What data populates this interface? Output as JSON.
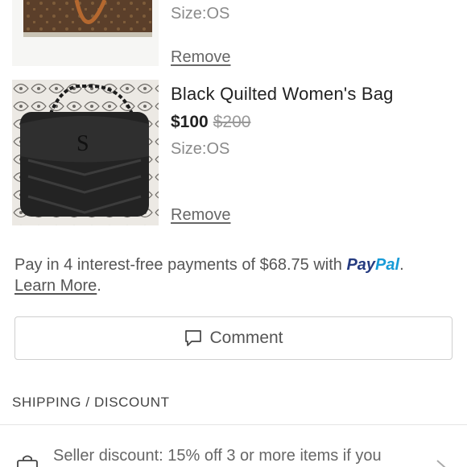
{
  "items": [
    {
      "title": "",
      "price": "",
      "original_price": "",
      "size": "Size:OS",
      "remove_label": "Remove"
    },
    {
      "title": "Black Quilted Women's Bag",
      "price": "$100",
      "original_price": "$200",
      "size": "Size:OS",
      "remove_label": "Remove"
    }
  ],
  "paypal": {
    "text": "Pay in 4 interest-free payments of $68.75 with ",
    "brand_pay": "Pay",
    "brand_pal": "Pal",
    "period": ".",
    "learn_more": "Learn More",
    "learn_more_period": "."
  },
  "comment": {
    "label": "Comment"
  },
  "shipping": {
    "header": "SHIPPING / DISCOUNT",
    "discount_text": "Seller discount: 15% off 3 or more items if you"
  },
  "colors": {
    "paypal_dark": "#253b80",
    "paypal_light": "#179bd7"
  }
}
